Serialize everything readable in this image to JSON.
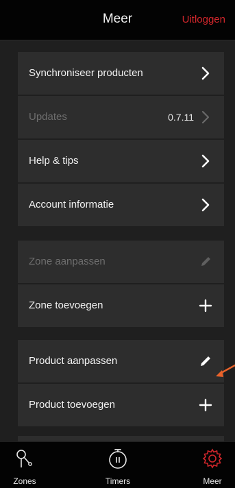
{
  "header": {
    "title": "Meer",
    "logout_label": "Uitloggen"
  },
  "settings_group": [
    {
      "label": "Synchroniseer producten",
      "value": "",
      "icon": "chevron-right-icon",
      "disabled": false
    },
    {
      "label": "Updates",
      "value": "0.7.11",
      "icon": "chevron-right-icon",
      "disabled": true
    },
    {
      "label": "Help & tips",
      "value": "",
      "icon": "chevron-right-icon",
      "disabled": false
    },
    {
      "label": "Account informatie",
      "value": "",
      "icon": "chevron-right-icon",
      "disabled": false
    }
  ],
  "zone_group": [
    {
      "label": "Zone aanpassen",
      "icon": "pencil-icon",
      "disabled": true
    },
    {
      "label": "Zone toevoegen",
      "icon": "plus-icon",
      "disabled": false
    }
  ],
  "product_group": [
    {
      "label": "Product aanpassen",
      "icon": "pencil-icon",
      "disabled": false
    },
    {
      "label": "Product toevoegen",
      "icon": "plus-icon",
      "disabled": false
    }
  ],
  "tabbar": {
    "tabs": [
      {
        "label": "Zones",
        "icon": "zones-icon",
        "active": false
      },
      {
        "label": "Timers",
        "icon": "stopwatch-icon",
        "active": false
      },
      {
        "label": "Meer",
        "icon": "gear-icon",
        "active": true
      }
    ]
  },
  "colors": {
    "accent": "#d1262b",
    "annotation": "#e8622a",
    "row_background": "#2d2d2d",
    "bar_background": "#030303"
  }
}
